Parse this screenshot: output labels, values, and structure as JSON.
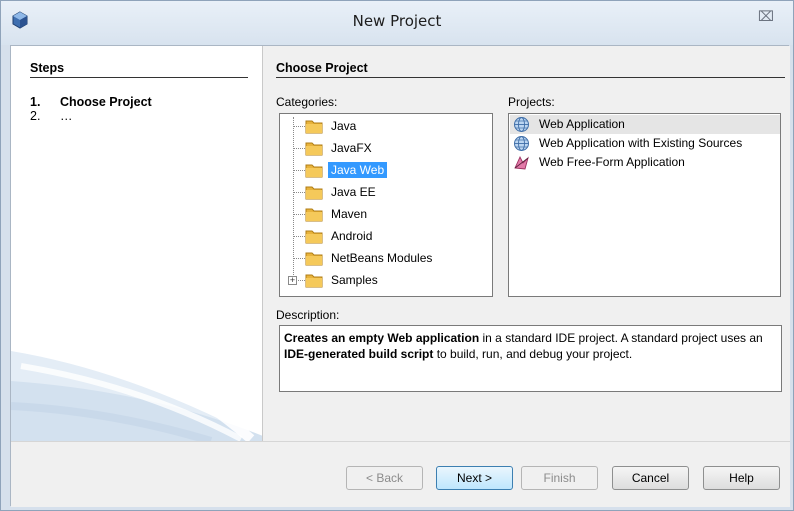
{
  "window": {
    "title": "New Project",
    "close_glyph": "⌧"
  },
  "steps": {
    "heading": "Steps",
    "items": [
      {
        "num": "1.",
        "label": "Choose Project"
      },
      {
        "num": "2.",
        "label": "…"
      }
    ]
  },
  "main": {
    "heading": "Choose Project",
    "categories_label": "Categories:",
    "projects_label": "Projects:",
    "description_label": "Description:",
    "categories": [
      {
        "label": "Java",
        "selected": false
      },
      {
        "label": "JavaFX",
        "selected": false
      },
      {
        "label": "Java Web",
        "selected": true
      },
      {
        "label": "Java EE",
        "selected": false
      },
      {
        "label": "Maven",
        "selected": false
      },
      {
        "label": "Android",
        "selected": false
      },
      {
        "label": "NetBeans Modules",
        "selected": false
      },
      {
        "label": "Samples",
        "selected": false,
        "expandable": true,
        "expander_glyph": "+"
      }
    ],
    "projects": [
      {
        "label": "Web Application",
        "icon": "globe-icon",
        "selected": true
      },
      {
        "label": "Web Application with Existing Sources",
        "icon": "globe-icon",
        "selected": false
      },
      {
        "label": "Web Free-Form Application",
        "icon": "freeform-icon",
        "selected": false
      }
    ],
    "description": {
      "part1_bold": "Creates an empty Web application",
      "part2": " in a standard IDE project. A standard project uses an ",
      "part3_bold": "IDE-generated build script",
      "part4": " to build, run, and debug your project."
    }
  },
  "buttons": {
    "back": "< Back",
    "next": "Next >",
    "finish": "Finish",
    "cancel": "Cancel",
    "help": "Help"
  },
  "colors": {
    "selection": "#3399ff",
    "folder": "#e8b33c",
    "title_bg": "#dfe8f2"
  }
}
